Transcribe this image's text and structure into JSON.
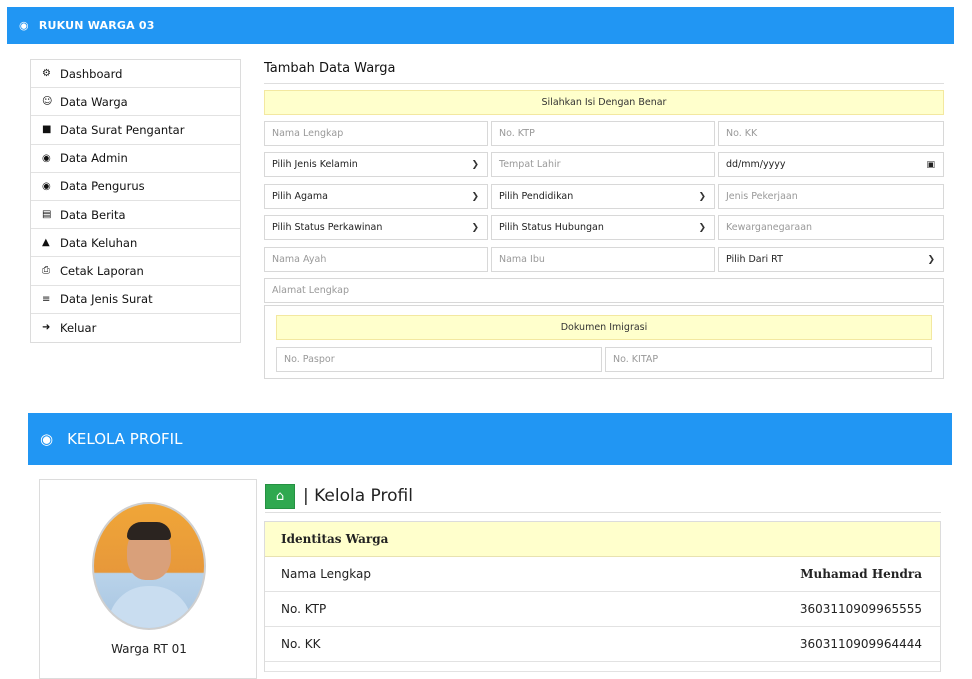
{
  "topbar": {
    "title": "RUKUN WARGA 03",
    "icon": "user-circle-icon"
  },
  "sidebar": {
    "items": [
      {
        "label": "Dashboard",
        "icon": "dashboard-icon",
        "glyph": "⚙"
      },
      {
        "label": "Data Warga",
        "icon": "user-icon",
        "glyph": "☺"
      },
      {
        "label": "Data Surat Pengantar",
        "icon": "file-icon",
        "glyph": "■"
      },
      {
        "label": "Data Admin",
        "icon": "user-circle-icon",
        "glyph": "◉"
      },
      {
        "label": "Data Pengurus",
        "icon": "user-circle-icon",
        "glyph": "◉"
      },
      {
        "label": "Data Berita",
        "icon": "newspaper-icon",
        "glyph": "▤"
      },
      {
        "label": "Data Keluhan",
        "icon": "warning-icon",
        "glyph": "▲"
      },
      {
        "label": "Cetak Laporan",
        "icon": "print-icon",
        "glyph": "⎙"
      },
      {
        "label": "Data Jenis Surat",
        "icon": "database-icon",
        "glyph": "≡"
      },
      {
        "label": "Keluar",
        "icon": "logout-icon",
        "glyph": "➜"
      }
    ]
  },
  "form": {
    "title": "Tambah Data Warga",
    "notice": "Silahkan Isi Dengan Benar",
    "nama_lengkap": "Nama Lengkap",
    "no_ktp": "No. KTP",
    "no_kk": "No. KK",
    "jenis_kelamin": "Pilih Jenis Kelamin",
    "tempat_lahir": "Tempat Lahir",
    "tanggal_lahir": "dd/mm/yyyy",
    "agama": "Pilih Agama",
    "pendidikan": "Pilih Pendidikan",
    "pekerjaan": "Jenis Pekerjaan",
    "status_perkawinan": "Pilih Status Perkawinan",
    "status_hubungan": "Pilih Status Hubungan",
    "kewarganegaraan": "Kewarganegaraan",
    "nama_ayah": "Nama Ayah",
    "nama_ibu": "Nama Ibu",
    "dari_rt": "Pilih Dari RT",
    "alamat": "Alamat Lengkap",
    "imigrasi": {
      "title": "Dokumen Imigrasi",
      "paspor": "No. Paspor",
      "kitap": "No. KITAP"
    }
  },
  "kelola": {
    "bar_title": "KELOLA PROFIL",
    "page_title": "| Kelola Profil",
    "role": "Warga RT 01",
    "identitas_header": "Identitas Warga",
    "rows": [
      {
        "label": "Nama Lengkap",
        "value": "Muhamad Hendra",
        "bold": true
      },
      {
        "label": "No. KTP",
        "value": "3603110909965555",
        "bold": false
      },
      {
        "label": "No. KK",
        "value": "3603110909964444",
        "bold": false
      }
    ]
  },
  "colors": {
    "primary": "#2196f3",
    "notice_bg": "#ffffcc",
    "success": "#2fa84f"
  }
}
